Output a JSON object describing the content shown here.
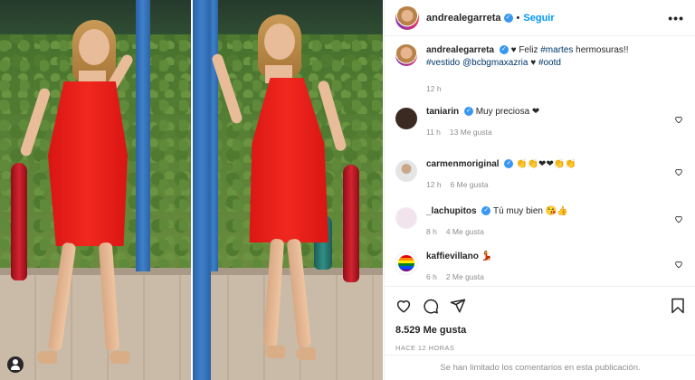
{
  "post": {
    "author": "andrealegarreta",
    "follow_label": "Seguir",
    "more_label": "•••",
    "verified_glyph": "✓"
  },
  "caption": {
    "user": "andrealegarreta",
    "heart": "♥",
    "text_before": "Feliz ",
    "tag_martes": "#martes",
    "text_middle": " hermosuras!!",
    "tag_vestido": "#vestido",
    "mention": "@bcbgmaxazria",
    "heart2": "♥",
    "tag_ootd": "#ootd",
    "time": "12 h"
  },
  "comments": [
    {
      "user": "taniarin",
      "text": "Muy preciosa ❤",
      "time": "11 h",
      "likes": "13 Me gusta",
      "avatar_color": "#3b2a22"
    },
    {
      "user": "carmenmoriginal",
      "text": "👏👏❤❤👏👏",
      "time": "12 h",
      "likes": "6 Me gusta",
      "avatar_color": "#d7d7d7"
    },
    {
      "user": "_lachupitos",
      "text": "Tú muy bien 😘👍",
      "time": "8 h",
      "likes": "4 Me gusta",
      "avatar_color": "#f2e4ec"
    },
    {
      "user": "kaffievillano",
      "text": "💃",
      "time": "6 h",
      "likes": "2 Me gusta",
      "avatar_color": "#ffffff"
    }
  ],
  "actions": {
    "like_count": "8.529 Me gusta",
    "posted_ago": "HACE 12 HORAS",
    "comments_limited": "Se han limitado los comentarios en esta publicación."
  },
  "icons": {
    "like": "heart-icon",
    "comment": "comment-icon",
    "share": "share-icon",
    "save": "bookmark-icon",
    "more": "more-icon",
    "profile": "profile-icon"
  },
  "colors": {
    "accent": "#0095f6",
    "verified": "#3897f0",
    "dress": "#e8201a",
    "pole": "#3573b8"
  }
}
